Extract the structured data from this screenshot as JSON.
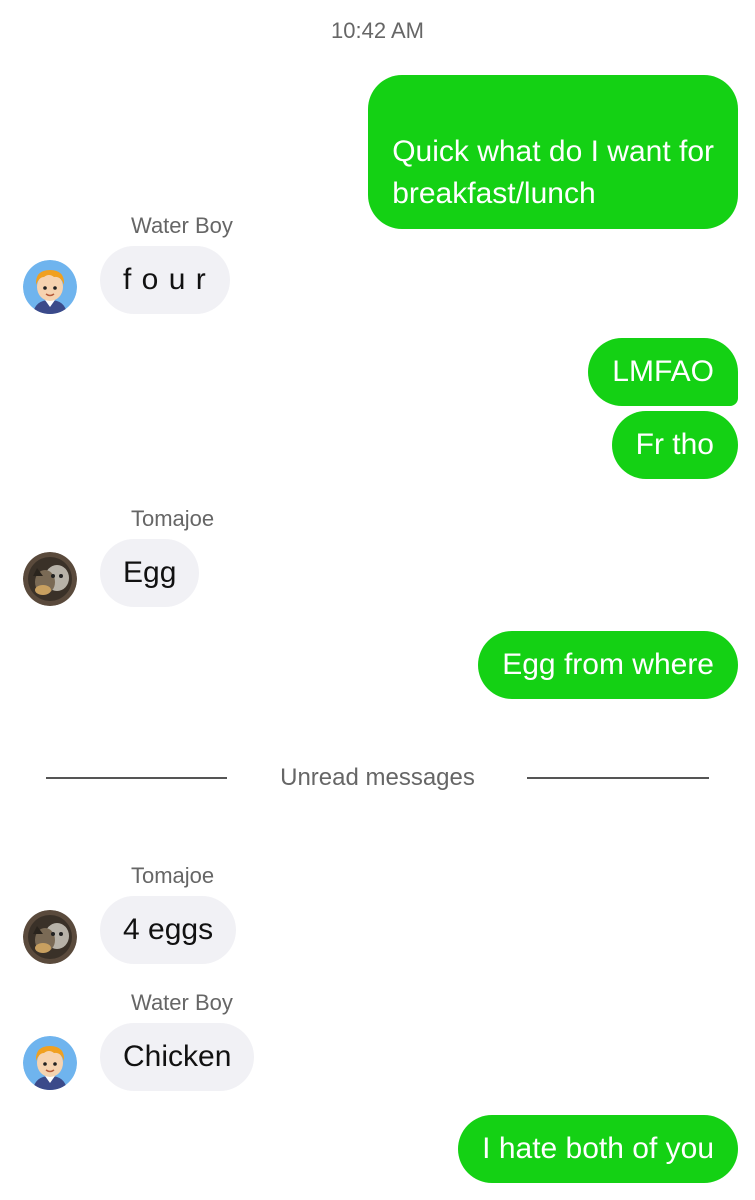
{
  "timestamp": "10:42 AM",
  "messages": [
    {
      "direction": "outgoing",
      "text": "Quick what do I want for\nbreakfast/lunch"
    },
    {
      "direction": "incoming",
      "sender": "Water Boy",
      "avatar": "cartoon-boy-icon",
      "text": "f o u r"
    },
    {
      "direction": "outgoing",
      "text": "LMFAO"
    },
    {
      "direction": "outgoing",
      "text": "Fr tho"
    },
    {
      "direction": "incoming",
      "sender": "Tomajoe",
      "avatar": "cat-photo-icon",
      "text": "Egg"
    },
    {
      "direction": "outgoing",
      "text": "Egg from where"
    },
    {
      "direction": "incoming",
      "sender": "Tomajoe",
      "avatar": "cat-photo-icon",
      "text": "4 eggs"
    },
    {
      "direction": "incoming",
      "sender": "Water Boy",
      "avatar": "cartoon-boy-icon",
      "text": "Chicken"
    },
    {
      "direction": "outgoing",
      "text": "I hate both of you"
    }
  ],
  "divider": {
    "label": "Unread messages"
  },
  "colors": {
    "outgoing_bubble": "#14d114",
    "incoming_bubble": "#f1f1f5",
    "meta_text": "#666666"
  }
}
